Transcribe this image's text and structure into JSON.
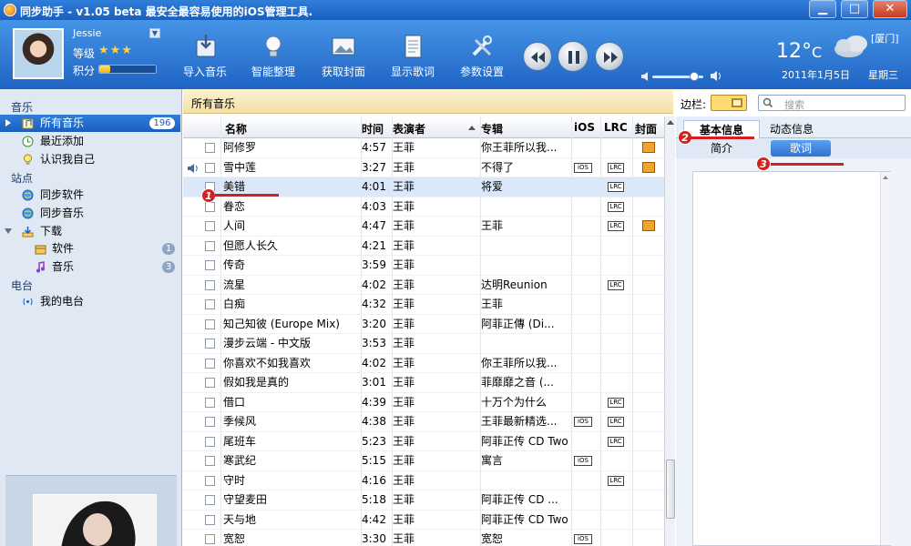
{
  "window": {
    "title": "同步助手 - v1.05 beta  最安全最容易使用的iOS管理工具."
  },
  "colors": {
    "accent": "#1f64c4",
    "selection": "#dbe8f9",
    "annotation": "#d42020"
  },
  "user": {
    "name": "Jessie",
    "level_label": "等级",
    "stars": "★★★",
    "points_label": "积分",
    "points_fraction": 0.2
  },
  "toolbar": {
    "import_music": "导入音乐",
    "smart_organize": "智能整理",
    "get_cover": "获取封面",
    "show_lyrics": "显示歌词",
    "settings": "参数设置"
  },
  "player": {
    "volume_fraction": 0.83
  },
  "weather": {
    "temp": "12°",
    "unit": "C",
    "city": "[厦门]",
    "date": "2011年1月5日",
    "weekday": "星期三"
  },
  "sidebar": {
    "music_section": "音乐",
    "all_music": "所有音乐",
    "all_music_count": "196",
    "recent_added": "最近添加",
    "know_myself": "认识我自己",
    "station_section": "站点",
    "sync_software": "同步软件",
    "sync_music": "同步音乐",
    "download": "下载",
    "dl_software": "软件",
    "dl_software_count": "1",
    "dl_music": "音乐",
    "dl_music_count": "3",
    "radio_section": "电台",
    "my_radio": "我的电台"
  },
  "path": {
    "current": "所有音乐"
  },
  "table": {
    "headers": {
      "name": "名称",
      "time": "时间",
      "artist": "表演者",
      "album": "专辑",
      "ios": "iOS",
      "lrc": "LRC",
      "cover": "封面"
    },
    "rows": [
      {
        "name": "阿修罗",
        "time": "4:57",
        "artist": "王菲",
        "album": "你王菲所以我...",
        "ios": false,
        "lrc": false,
        "cover": true
      },
      {
        "name": "雪中莲",
        "time": "3:27",
        "artist": "王菲",
        "album": "不得了",
        "ios": true,
        "lrc": true,
        "cover": true,
        "playing": true
      },
      {
        "name": "美错",
        "time": "4:01",
        "artist": "王菲",
        "album": "将爱",
        "ios": false,
        "lrc": true,
        "cover": false,
        "selected": true
      },
      {
        "name": "眷恋",
        "time": "4:03",
        "artist": "王菲",
        "album": "",
        "ios": false,
        "lrc": true,
        "cover": false
      },
      {
        "name": "人间",
        "time": "4:47",
        "artist": "王菲",
        "album": "王菲",
        "ios": false,
        "lrc": true,
        "cover": true
      },
      {
        "name": "但愿人长久",
        "time": "4:21",
        "artist": "王菲",
        "album": "",
        "ios": false,
        "lrc": false,
        "cover": false
      },
      {
        "name": "传奇",
        "time": "3:59",
        "artist": "王菲",
        "album": "",
        "ios": false,
        "lrc": false,
        "cover": false
      },
      {
        "name": "流星",
        "time": "4:02",
        "artist": "王菲",
        "album": "达明Reunion",
        "ios": false,
        "lrc": true,
        "cover": false
      },
      {
        "name": "白痴",
        "time": "4:32",
        "artist": "王菲",
        "album": "王菲",
        "ios": false,
        "lrc": false,
        "cover": false
      },
      {
        "name": "知己知彼 (Europe Mix)",
        "time": "3:20",
        "artist": "王菲",
        "album": "阿菲正傳 (Di...",
        "ios": false,
        "lrc": false,
        "cover": false
      },
      {
        "name": "漫步云端 - 中文版",
        "time": "3:53",
        "artist": "王菲",
        "album": "",
        "ios": false,
        "lrc": false,
        "cover": false
      },
      {
        "name": "你喜欢不如我喜欢",
        "time": "4:02",
        "artist": "王菲",
        "album": "你王菲所以我...",
        "ios": false,
        "lrc": false,
        "cover": false
      },
      {
        "name": "假如我是真的",
        "time": "3:01",
        "artist": "王菲",
        "album": "菲靡靡之音 (...",
        "ios": false,
        "lrc": false,
        "cover": false
      },
      {
        "name": "借口",
        "time": "4:39",
        "artist": "王菲",
        "album": "十万个为什么",
        "ios": false,
        "lrc": true,
        "cover": false
      },
      {
        "name": "季候风",
        "time": "4:38",
        "artist": "王菲",
        "album": "王菲最新精选...",
        "ios": true,
        "lrc": true,
        "cover": false
      },
      {
        "name": "尾班车",
        "time": "5:23",
        "artist": "王菲",
        "album": "阿菲正传 CD Two",
        "ios": false,
        "lrc": true,
        "cover": false
      },
      {
        "name": "寒武纪",
        "time": "5:15",
        "artist": "王菲",
        "album": "寓言",
        "ios": true,
        "lrc": false,
        "cover": false
      },
      {
        "name": "守时",
        "time": "4:16",
        "artist": "王菲",
        "album": "",
        "ios": false,
        "lrc": true,
        "cover": false
      },
      {
        "name": "守望麦田",
        "time": "5:18",
        "artist": "王菲",
        "album": "阿菲正传 CD ...",
        "ios": false,
        "lrc": false,
        "cover": false
      },
      {
        "name": "天与地",
        "time": "4:42",
        "artist": "王菲",
        "album": "阿菲正传 CD Two",
        "ios": false,
        "lrc": false,
        "cover": false
      },
      {
        "name": "宽恕",
        "time": "3:30",
        "artist": "王菲",
        "album": "宽恕",
        "ios": true,
        "lrc": false,
        "cover": false
      }
    ],
    "tag_ios": "iOS",
    "tag_lrc": "LRC"
  },
  "right_panel": {
    "sidebar_toggle_label": "边栏:",
    "search_placeholder": "搜索",
    "tab_basic": "基本信息",
    "tab_dynamic": "动态信息",
    "subtab_intro": "简介",
    "subtab_lyrics": "歌词"
  },
  "annotations": {
    "m1": "1",
    "m2": "2",
    "m3": "3"
  }
}
